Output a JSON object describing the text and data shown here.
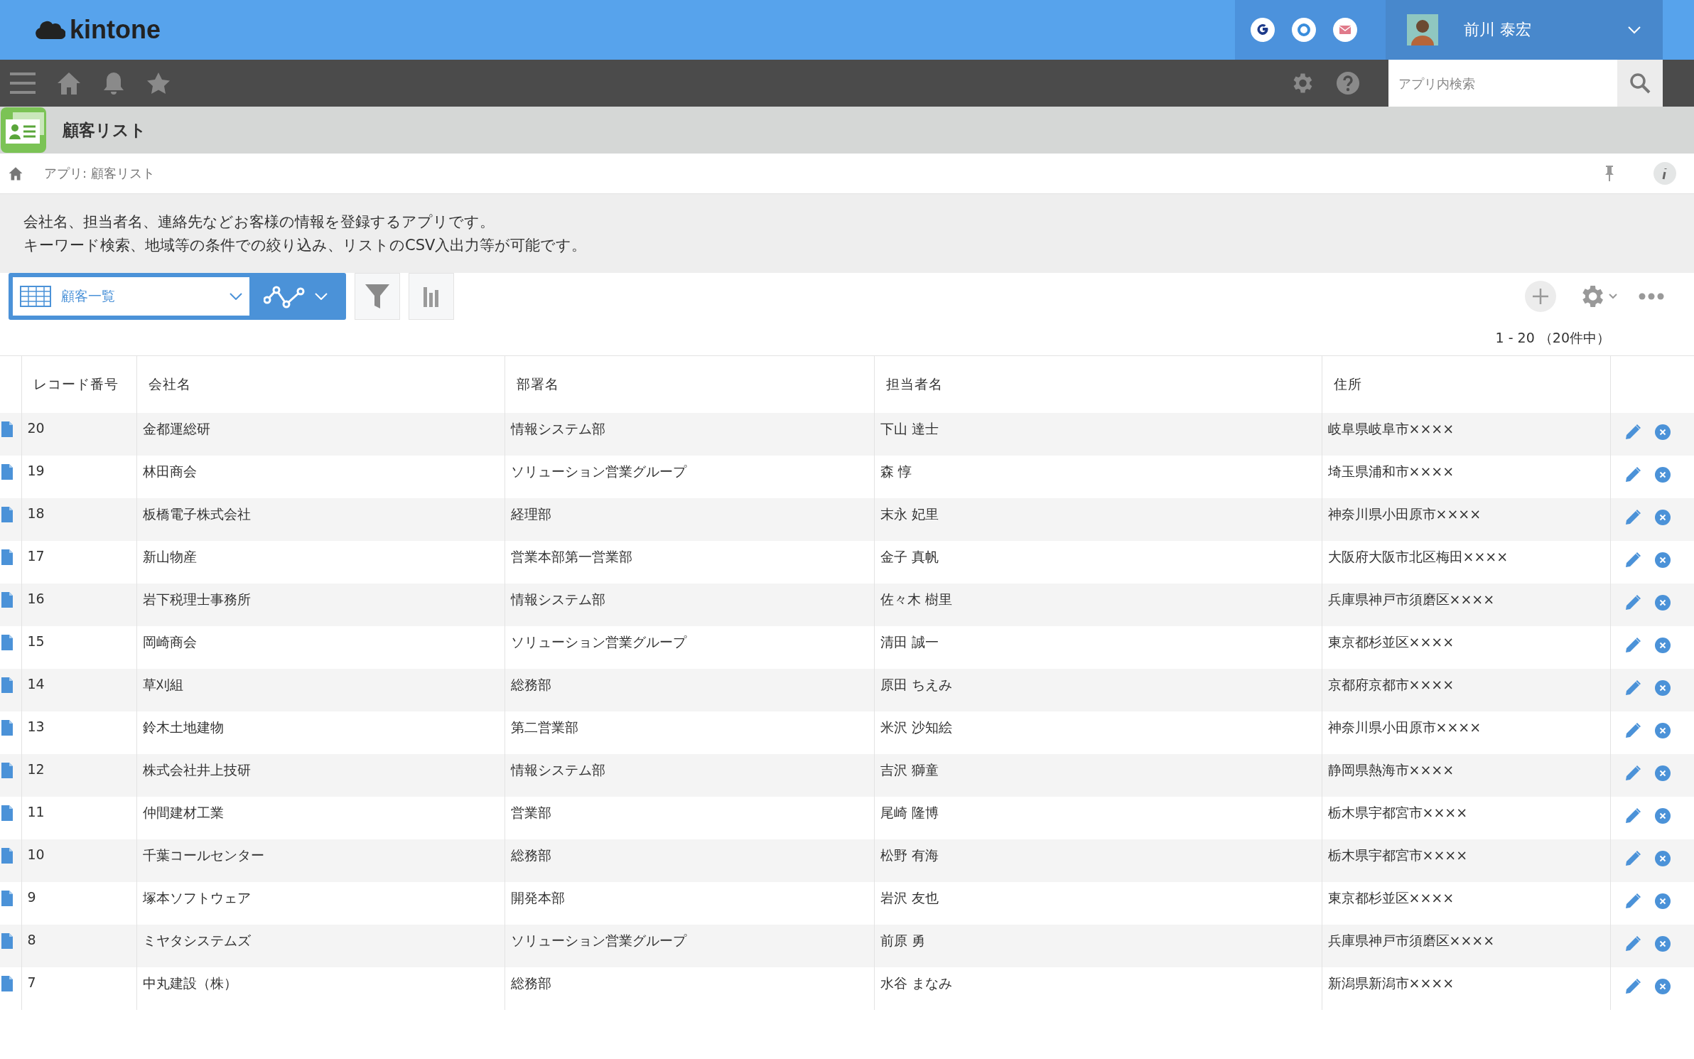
{
  "header": {
    "logo": "kintone",
    "user_name": "前川 泰宏"
  },
  "nav": {
    "search": {
      "placeholder": "アプリ内検索"
    }
  },
  "app": {
    "title": "顧客リスト"
  },
  "breadcrumb": {
    "text": "アプリ: 顧客リスト"
  },
  "description": [
    "会社名、担当者名、連絡先などお客様の情報を登録するアプリです。",
    "キーワード検索、地域等の条件での絞り込み、リストのCSV入出力等が可能です。"
  ],
  "toolbar": {
    "view": "顧客一覧"
  },
  "pagination": "1 - 20 （20件中）",
  "table": {
    "columns": [
      "レコード番号",
      "会社名",
      "部署名",
      "担当者名",
      "住所"
    ],
    "rows": [
      {
        "cells": [
          "20",
          "金都運総研",
          "情報システム部",
          "下山 達士",
          "岐阜県岐阜市××××"
        ]
      },
      {
        "cells": [
          "19",
          "林田商会",
          "ソリューション営業グループ",
          "森 惇",
          "埼玉県浦和市××××"
        ]
      },
      {
        "cells": [
          "18",
          "板橋電子株式会社",
          "経理部",
          "末永 妃里",
          "神奈川県小田原市××××"
        ]
      },
      {
        "cells": [
          "17",
          "新山物産",
          "営業本部第一営業部",
          "金子 真帆",
          "大阪府大阪市北区梅田××××"
        ]
      },
      {
        "cells": [
          "16",
          "岩下税理士事務所",
          "情報システム部",
          "佐々木 樹里",
          "兵庫県神戸市須磨区××××"
        ]
      },
      {
        "cells": [
          "15",
          "岡崎商会",
          "ソリューション営業グループ",
          "清田 誠一",
          "東京都杉並区××××"
        ]
      },
      {
        "cells": [
          "14",
          "草刈組",
          "総務部",
          "原田 ちえみ",
          "京都府京都市××××"
        ]
      },
      {
        "cells": [
          "13",
          "鈴木土地建物",
          "第二営業部",
          "米沢 沙知絵",
          "神奈川県小田原市××××"
        ]
      },
      {
        "cells": [
          "12",
          "株式会社井上技研",
          "情報システム部",
          "吉沢 獅童",
          "静岡県熱海市××××"
        ]
      },
      {
        "cells": [
          "11",
          "仲間建材工業",
          "営業部",
          "尾崎 隆博",
          "栃木県宇都宮市××××"
        ]
      },
      {
        "cells": [
          "10",
          "千葉コールセンター",
          "総務部",
          "松野 有海",
          "栃木県宇都宮市××××"
        ]
      },
      {
        "cells": [
          "9",
          "塚本ソフトウェア",
          "開発本部",
          "岩沢 友也",
          "東京都杉並区××××"
        ]
      },
      {
        "cells": [
          "8",
          "ミヤタシステムズ",
          "ソリューション営業グループ",
          "前原 勇",
          "兵庫県神戸市須磨区××××"
        ]
      },
      {
        "cells": [
          "7",
          "中丸建設（株）",
          "総務部",
          "水谷 まなみ",
          "新潟県新潟市××××"
        ]
      }
    ]
  }
}
